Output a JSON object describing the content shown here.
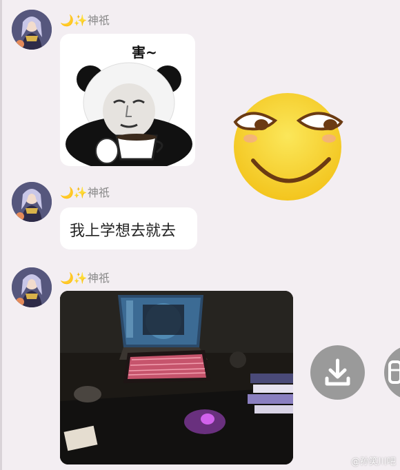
{
  "messages": [
    {
      "sender": {
        "moon": "🌙",
        "sparkle": "✨",
        "name": "神祇"
      },
      "type": "sticker",
      "sticker_text": "害~"
    },
    {
      "sender": {
        "moon": "🌙",
        "sparkle": "✨",
        "name": "神祇"
      },
      "type": "text",
      "text": "我上学想去就去"
    },
    {
      "sender": {
        "moon": "🌙",
        "sparkle": "✨",
        "name": "神祇"
      },
      "type": "photo"
    }
  ],
  "floating_emoji": "smirking-face",
  "actions": {
    "download": "download-icon",
    "next": "next-icon"
  },
  "watermark": "@孙笑川吧",
  "colors": {
    "background": "#f3eef2",
    "bubble": "#ffffff",
    "button": "#9a9a9a",
    "keyboard_glow": "#ff6a8a",
    "emoji_yellow": "#f7d83a"
  }
}
